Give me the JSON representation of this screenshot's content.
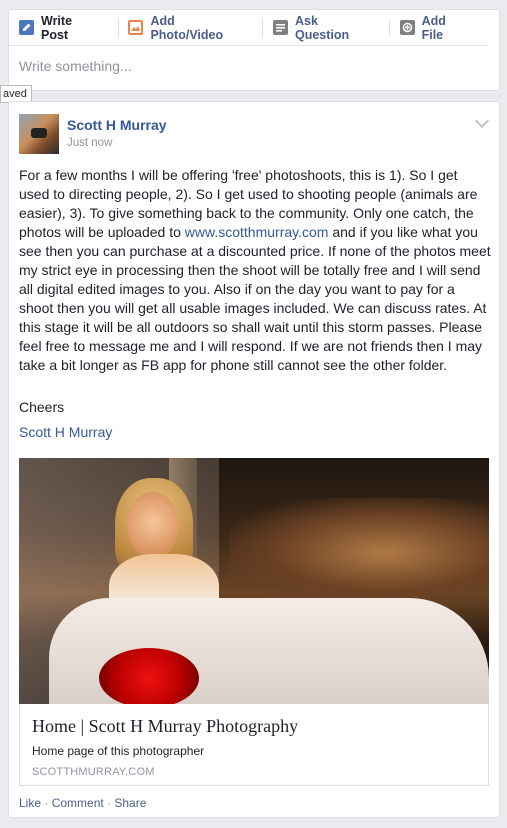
{
  "composer": {
    "tabs": [
      {
        "label": "Write Post",
        "icon": "pencil-icon"
      },
      {
        "label": "Add Photo/Video",
        "icon": "photo-icon"
      },
      {
        "label": "Ask Question",
        "icon": "question-icon"
      },
      {
        "label": "Add File",
        "icon": "file-icon"
      }
    ],
    "placeholder": "Write something..."
  },
  "tooltip": "aved",
  "post": {
    "author": "Scott H Murray",
    "timestamp": "Just now",
    "body_before_link": "For a few months I will be offering 'free' photoshoots, this is 1). So I get used to directing people, 2). So I get used to shooting people (animals are easier), 3). To give something back to the community. Only one catch, the photos will be uploaded to ",
    "body_link": "www.scotthmurray.com",
    "body_after_link": " and if you like what you see then you can purchase at a discounted price. If none of the photos meet my strict eye in processing then the shoot will be totally free and I will send all digital edited images to you. Also if on the day you want to pay for a shoot then you will get all usable images included. We can discuss rates. At this stage it will be all outdoors so shall wait until this storm passes. Please feel free to message me and I will respond. If we are not friends then I may take a bit longer as FB app for phone still cannot see the other folder.",
    "cheers": "Cheers",
    "signature": "Scott H Murray",
    "link_card": {
      "title": "Home | Scott H Murray Photography",
      "description": "Home page of this photographer",
      "domain": "SCOTTHMURRAY.COM"
    },
    "actions": {
      "like": "Like",
      "comment": "Comment",
      "share": "Share",
      "separator": " · "
    }
  },
  "colors": {
    "link": "#365899",
    "accent_orange": "#e9844d",
    "accent_blue": "#4b77be"
  }
}
